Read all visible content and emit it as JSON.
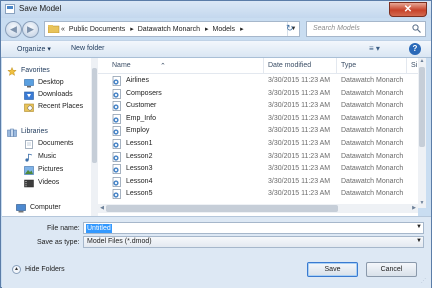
{
  "window": {
    "title": "Save Model",
    "close_glyph": "✕"
  },
  "nav": {
    "back_glyph": "◀",
    "forward_glyph": "▶",
    "address": {
      "chevron": "«",
      "crumbs": [
        "Public Documents",
        "Datawatch Monarch",
        "Models"
      ],
      "separator": "▸"
    },
    "search_placeholder": "Search Models"
  },
  "toolbar": {
    "organize_label": "Organize ▾",
    "new_folder_label": "New folder",
    "view_glyph": "≡ ▾",
    "help_glyph": "?"
  },
  "sidebar": {
    "favorites": {
      "label": "Favorites",
      "items": [
        "Desktop",
        "Downloads",
        "Recent Places"
      ]
    },
    "libraries": {
      "label": "Libraries",
      "items": [
        "Documents",
        "Music",
        "Pictures",
        "Videos"
      ]
    },
    "computer": {
      "label": "Computer"
    }
  },
  "file_list": {
    "columns": {
      "name": "Name",
      "date": "Date modified",
      "type": "Type",
      "size": "Si"
    },
    "rows": [
      {
        "name": "Airlines",
        "date": "3/30/2015 11:23 AM",
        "type": "Datawatch Monarch"
      },
      {
        "name": "Composers",
        "date": "3/30/2015 11:23 AM",
        "type": "Datawatch Monarch"
      },
      {
        "name": "Customer",
        "date": "3/30/2015 11:23 AM",
        "type": "Datawatch Monarch"
      },
      {
        "name": "Emp_Info",
        "date": "3/30/2015 11:23 AM",
        "type": "Datawatch Monarch"
      },
      {
        "name": "Employ",
        "date": "3/30/2015 11:23 AM",
        "type": "Datawatch Monarch"
      },
      {
        "name": "Lesson1",
        "date": "3/30/2015 11:23 AM",
        "type": "Datawatch Monarch"
      },
      {
        "name": "Lesson2",
        "date": "3/30/2015 11:23 AM",
        "type": "Datawatch Monarch"
      },
      {
        "name": "Lesson3",
        "date": "3/30/2015 11:23 AM",
        "type": "Datawatch Monarch"
      },
      {
        "name": "Lesson4",
        "date": "3/30/2015 11:23 AM",
        "type": "Datawatch Monarch"
      },
      {
        "name": "Lesson5",
        "date": "3/30/2015 11:23 AM",
        "type": "Datawatch Monarch"
      }
    ]
  },
  "form": {
    "file_name_label": "File name:",
    "file_name_value": "Untitled",
    "save_as_type_label": "Save as type:",
    "save_as_type_value": "Model Files (*.dmod)"
  },
  "footer": {
    "hide_folders_label": "Hide Folders",
    "save_label": "Save",
    "cancel_label": "Cancel"
  },
  "colors": {
    "accent": "#3399ff",
    "frame": "#c9ddf1",
    "close": "#c7432a"
  }
}
